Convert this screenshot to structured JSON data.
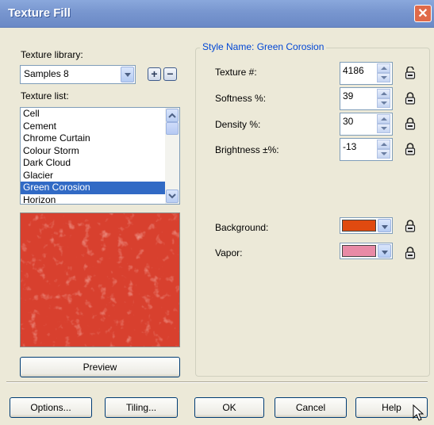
{
  "window": {
    "title": "Texture Fill",
    "close_label": "✕"
  },
  "left": {
    "library_label": "Texture library:",
    "library_value": "Samples 8",
    "list_label": "Texture list:",
    "textures": [
      "Cell",
      "Cement",
      "Chrome Curtain",
      "Colour Storm",
      "Dark Cloud",
      "Glacier",
      "Green Corosion",
      "Horizon"
    ],
    "selected_texture": "Green Corosion",
    "preview_button": "Preview",
    "add_symbol": "+",
    "remove_symbol": "−"
  },
  "style": {
    "group_title": "Style Name: Green Corosion",
    "params": [
      {
        "label": "Texture #:",
        "value": "4186"
      },
      {
        "label": "Softness %:",
        "value": "39"
      },
      {
        "label": "Density %:",
        "value": "30"
      },
      {
        "label": "Brightness ±%:",
        "value": "-13"
      }
    ],
    "colors": [
      {
        "label": "Background:",
        "color": "#e04a10"
      },
      {
        "label": "Vapor:",
        "color": "#e88aa6"
      }
    ]
  },
  "buttons": {
    "options": "Options...",
    "tiling": "Tiling...",
    "ok": "OK",
    "cancel": "Cancel",
    "help": "Help"
  },
  "preview_color": "#d8402e"
}
